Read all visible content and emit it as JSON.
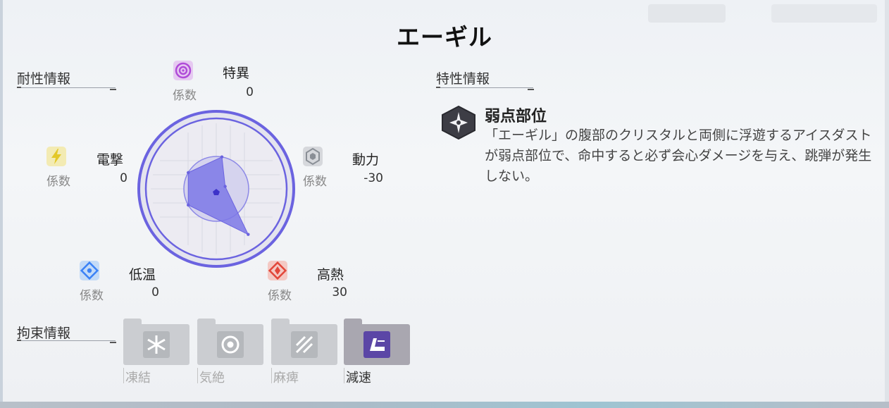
{
  "title": "エーギル",
  "resistance": {
    "section_label": "耐性情報",
    "coef_label": "係数",
    "elements": [
      {
        "key": "anomaly",
        "name": "特異",
        "value": "0",
        "icon": "anomaly-ring-icon",
        "color": "#b04bd8"
      },
      {
        "key": "electric",
        "name": "電撃",
        "value": "0",
        "icon": "lightning-icon",
        "color": "#e8d23a"
      },
      {
        "key": "kinetic",
        "name": "動力",
        "value": "-30",
        "icon": "kinetic-hexagon-icon",
        "color": "#8a8f96"
      },
      {
        "key": "cold",
        "name": "低温",
        "value": "0",
        "icon": "snowflake-icon",
        "color": "#3b82f6"
      },
      {
        "key": "heat",
        "name": "高熱",
        "value": "30",
        "icon": "flame-diamond-icon",
        "color": "#e2473a"
      }
    ]
  },
  "trait": {
    "section_label": "特性情報",
    "name": "弱点部位",
    "icon": "weakpoint-star-icon",
    "description": "「エーギル」の腹部のクリスタルと両側に浮遊するアイスダストが弱点部位で、命中すると必ず会心ダメージを与え、跳弾が発生しない。"
  },
  "control": {
    "section_label": "拘束情報",
    "items": [
      {
        "label": "凍結",
        "icon": "freeze-icon",
        "active": false
      },
      {
        "label": "気絶",
        "icon": "stun-swirl-icon",
        "active": false
      },
      {
        "label": "麻痺",
        "icon": "paralysis-icon",
        "active": false
      },
      {
        "label": "減速",
        "icon": "slow-icon",
        "active": true
      }
    ]
  },
  "colors": {
    "radar_ring": "#6b63e0",
    "radar_fill": "#7d78e6",
    "slow_icon_bg": "#5b46a6"
  }
}
